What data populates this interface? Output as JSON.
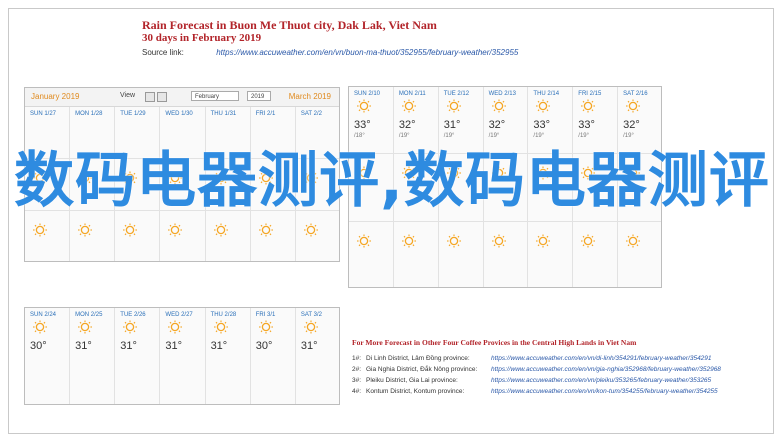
{
  "header": {
    "title": "Rain Forecast in Buon Me Thuot city, Dak Lak, Viet Nam",
    "subtitle": "30 days in February 2019",
    "source_label": "Source link:",
    "source_url": "https://www.accuweather.com/en/vn/buon-ma-thuot/352955/february-weather/352955"
  },
  "left_calendar": {
    "prev": "January 2019",
    "view_label": "View",
    "month_select": "February",
    "year_select": "2019",
    "next": "March 2019",
    "days": [
      "SUN 1/27",
      "MON 1/28",
      "TUE 1/29",
      "WED 1/30",
      "THU 1/31",
      "FRI 2/1",
      "SAT 2/2"
    ]
  },
  "right_calendar": {
    "days": [
      "SUN 2/10",
      "MON 2/11",
      "TUE 2/12",
      "WED 2/13",
      "THU 2/14",
      "FRI 2/15",
      "SAT 2/16"
    ],
    "highs": [
      "33°",
      "32°",
      "31°",
      "32°",
      "33°",
      "33°",
      "32°"
    ],
    "lows": [
      "/18°",
      "/19°",
      "/19°",
      "/19°",
      "/19°",
      "/19°",
      "/19°"
    ]
  },
  "bottom_calendar": {
    "days": [
      "SUN 2/24",
      "MON 2/25",
      "TUE 2/26",
      "WED 2/27",
      "THU 2/28",
      "FRI 3/1",
      "SAT 3/2"
    ],
    "highs": [
      "30°",
      "31°",
      "31°",
      "31°",
      "31°",
      "30°",
      "31°"
    ]
  },
  "more": {
    "title": "For More Forecast in Other Four Coffee Provices in the Central High Lands in Viet Nam",
    "rows": [
      {
        "num": "1#:",
        "name": "Di Linh District, Lâm Đồng province:",
        "url": "https://www.accuweather.com/en/vn/di-linh/354291/february-weather/354291"
      },
      {
        "num": "2#:",
        "name": "Gia Nghia District, Đắk Nông province:",
        "url": "https://www.accuweather.com/en/vn/gia-nghia/352968/february-weather/352968"
      },
      {
        "num": "3#:",
        "name": "Pleiku District, Gia Lai province:",
        "url": "https://www.accuweather.com/en/vn/pleiku/353265/february-weather/353265"
      },
      {
        "num": "4#:",
        "name": "Kontum District, Kontum province:",
        "url": "https://www.accuweather.com/en/vn/kon-tum/354255/february-weather/354255"
      }
    ]
  },
  "watermark": "数码电器测评,数码电器测评",
  "colors": {
    "title": "#b2242a",
    "link": "#2a58a8",
    "watermark": "#2e8be0",
    "sun": "#f5a623"
  }
}
